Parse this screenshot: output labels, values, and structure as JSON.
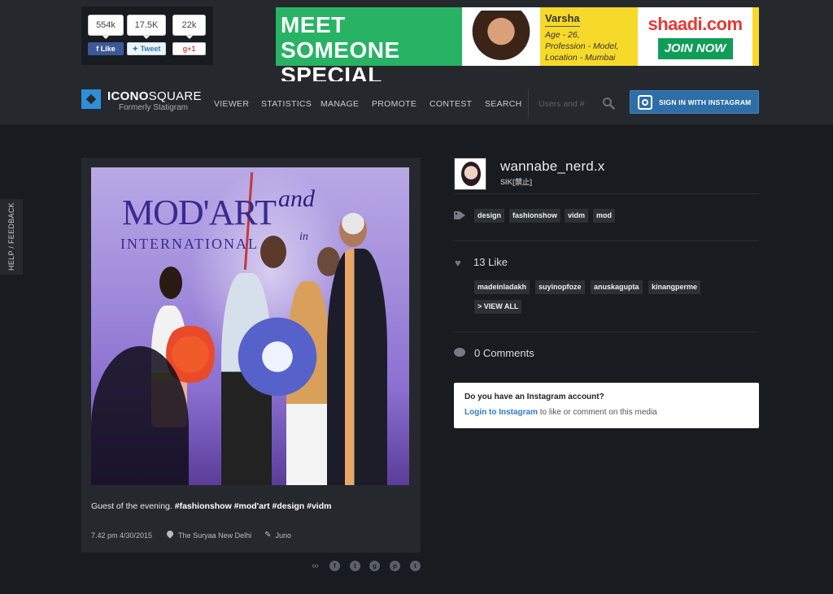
{
  "social": {
    "facebook": {
      "count": "554k",
      "label": "Like"
    },
    "twitter": {
      "count": "17.5K",
      "label": "Tweet"
    },
    "gplus": {
      "count": "22k",
      "label": "g+1"
    }
  },
  "ad": {
    "headline_1": "MEET SOMEONE",
    "headline_2": "SPECIAL",
    "profile_name": "Varsha",
    "profile_age": "Age - 26,",
    "profile_job": "Profession - Model,",
    "profile_location": "Location - Mumbai",
    "brand": "shaadi.com",
    "cta": "JOIN NOW"
  },
  "nav": {
    "logo_title_a": "ICONO",
    "logo_title_b": "SQUARE",
    "logo_subtitle": "Formerly Statigram",
    "items": [
      "VIEWER",
      "STATISTICS",
      "MANAGE",
      "PROMOTE",
      "CONTEST",
      "SEARCH"
    ],
    "search_placeholder": "Users and #",
    "signin_label": "SIGN IN WITH INSTAGRAM"
  },
  "feedback_label": "HELP / FEEDBACK",
  "photo_text": {
    "brand_line": "MOD'ART",
    "brand_sub": "INTERNATIONAL",
    "and_word": "and",
    "in_word": "in"
  },
  "media": {
    "caption_text": "Guest of the evening.",
    "caption_tags": "#fashionshow #mod'art #design #vidm",
    "timestamp": "7.42 pm 4/30/2015",
    "location": "The Suryaa New Delhi",
    "filter": "Juno"
  },
  "share_icons": [
    "link-icon",
    "facebook-icon",
    "twitter-icon",
    "pinterest-icon",
    "tumblr-icon"
  ],
  "user": {
    "username": "wannabe_nerd.x",
    "fullname": "SIK[禁止]"
  },
  "tags": [
    "design",
    "fashionshow",
    "vidm",
    "mod"
  ],
  "likes": {
    "count_label": "13 Like",
    "users": [
      "madeinladakh",
      "suyinopfoze",
      "anuskagupta",
      "kinangperme"
    ],
    "view_all": "> VIEW ALL"
  },
  "comments_label": "0 Comments",
  "login_box": {
    "question": "Do you have an Instagram account?",
    "link": "Login to Instagram",
    "suffix": " to like or comment on this media"
  },
  "colors": {
    "accent_blue": "#2e8fd8",
    "signin_blue": "#2e6ea6",
    "ad_green": "#27b363",
    "ad_yellow": "#f7d92a"
  }
}
